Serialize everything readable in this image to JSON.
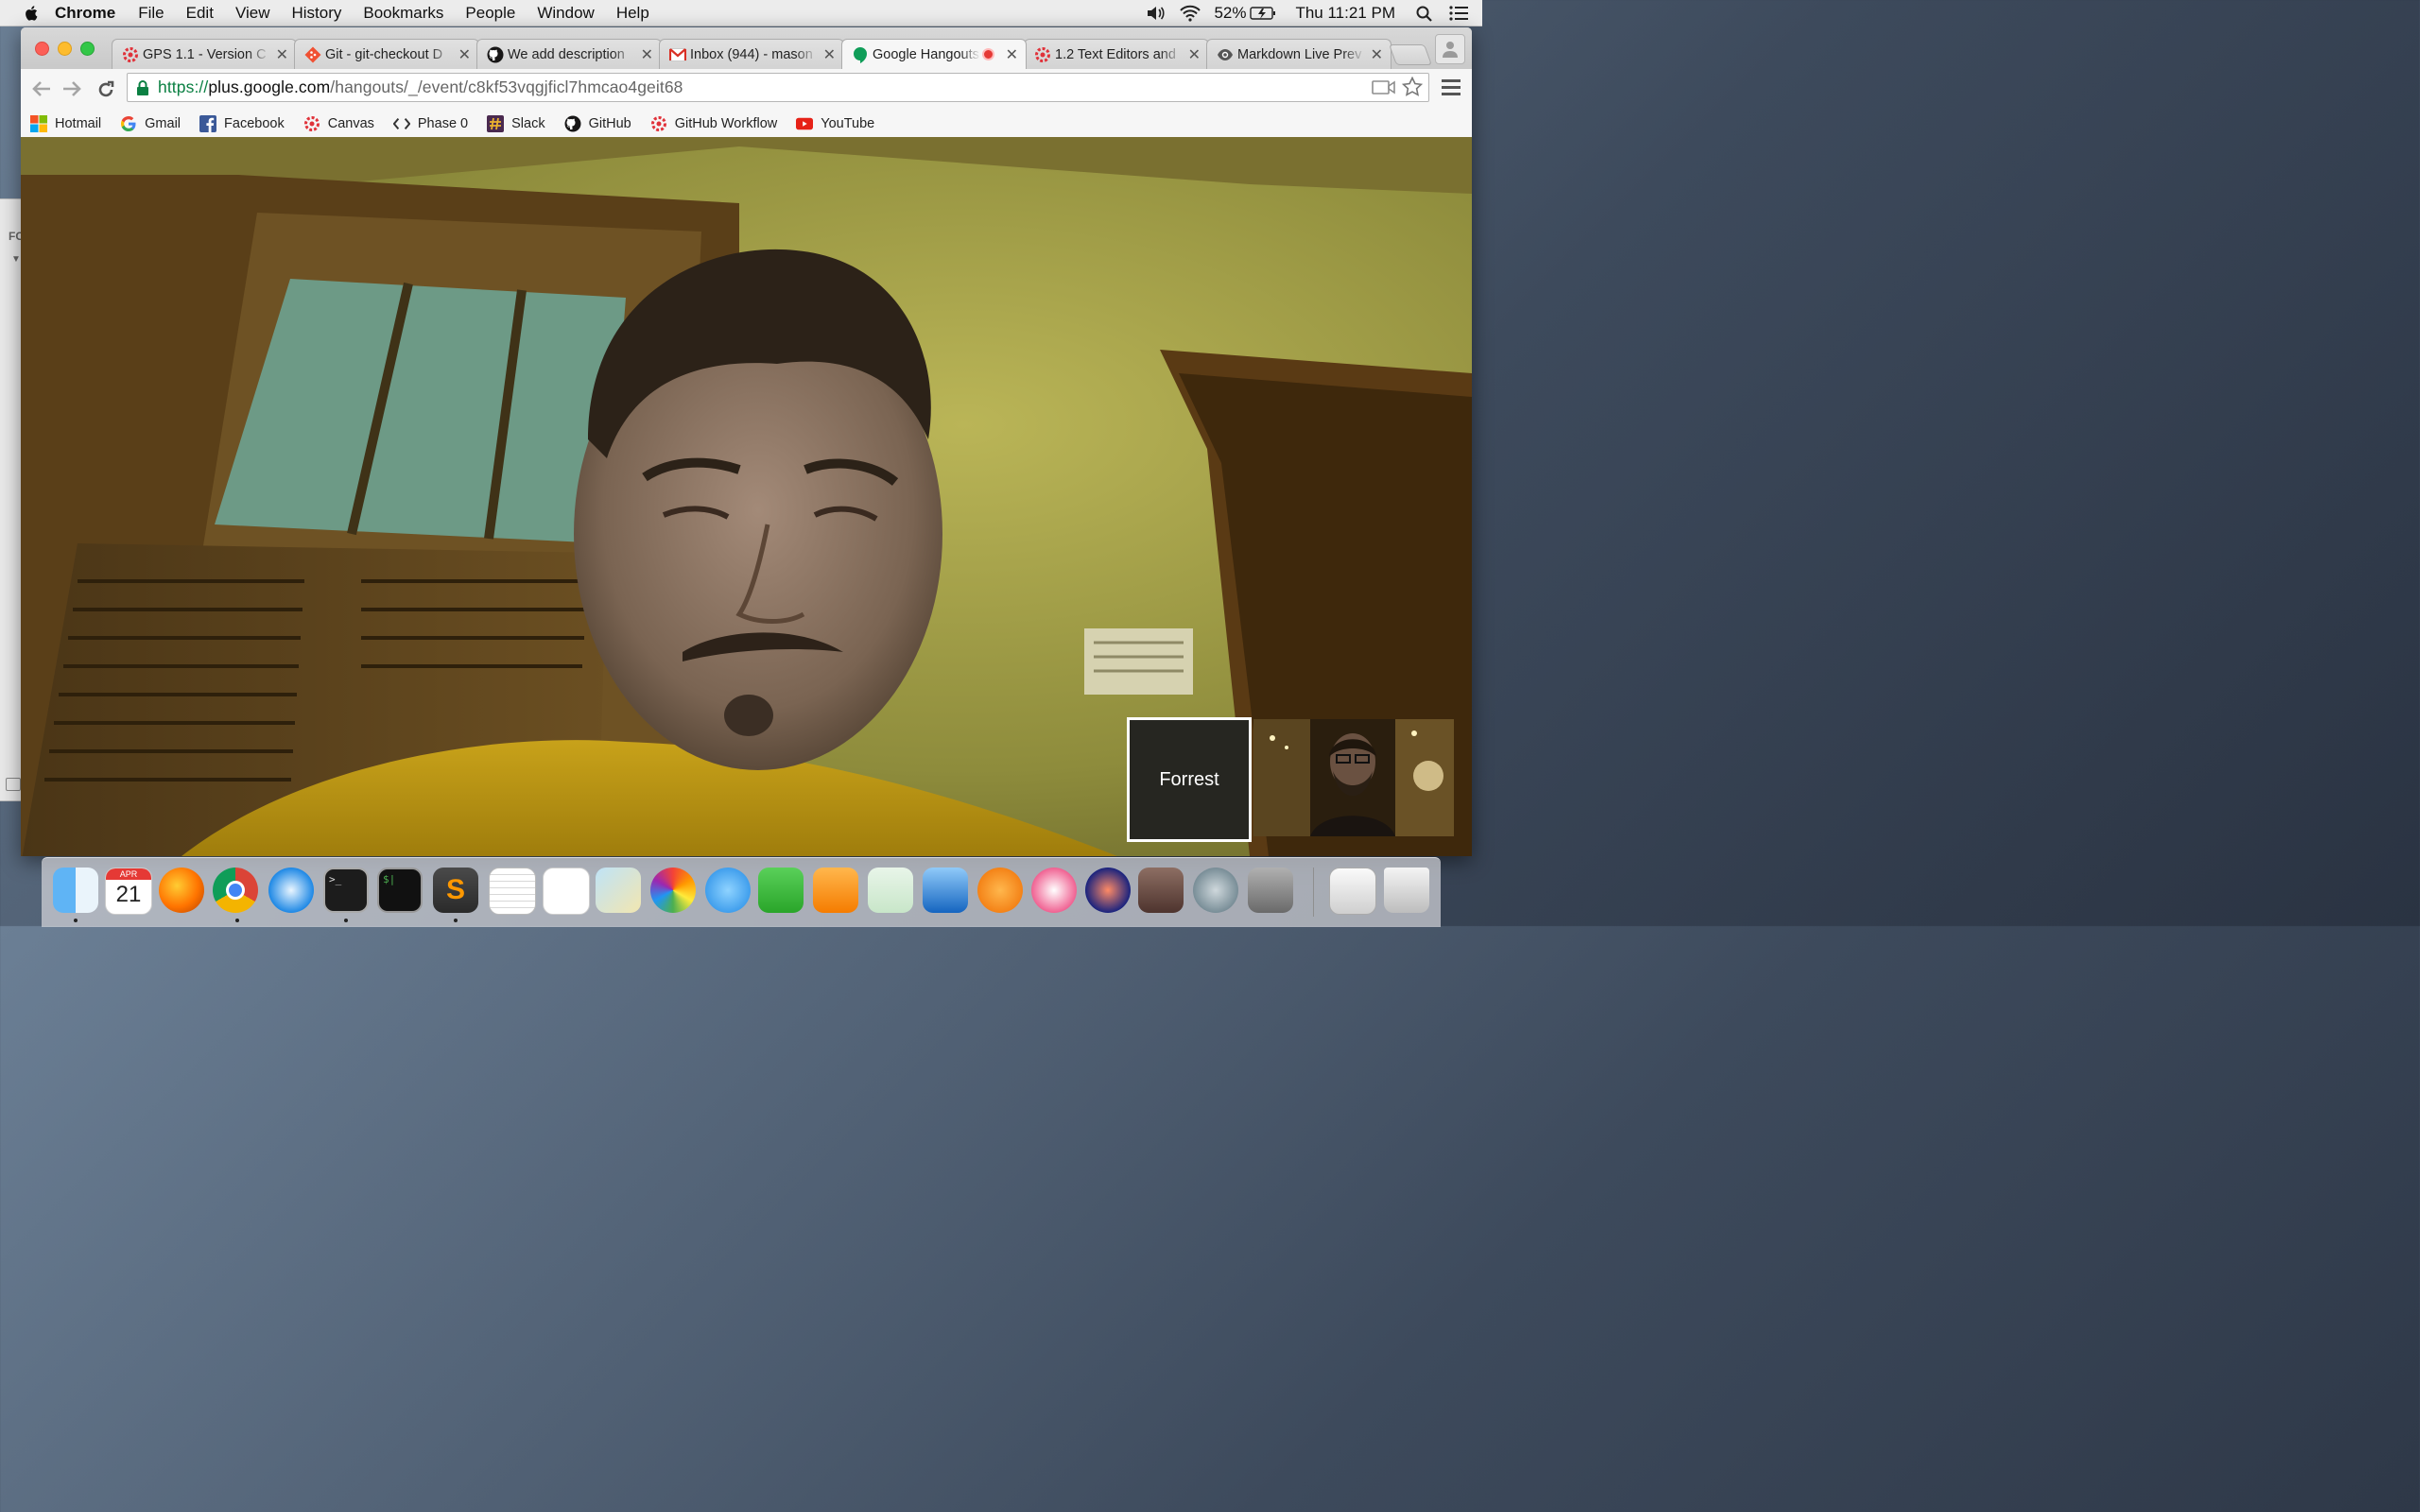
{
  "menubar": {
    "app_name": "Chrome",
    "menus": [
      "File",
      "Edit",
      "View",
      "History",
      "Bookmarks",
      "People",
      "Window",
      "Help"
    ],
    "battery": "52%",
    "clock": "Thu 11:21 PM"
  },
  "background_window": {
    "label_fragment": "FC"
  },
  "tabs": [
    {
      "title": "GPS 1.1 - Version C",
      "favicon": "gear-icon"
    },
    {
      "title": "Git - git-checkout D",
      "favicon": "git-icon"
    },
    {
      "title": "We add description",
      "favicon": "github-icon"
    },
    {
      "title": "Inbox (944) - mason",
      "favicon": "gmail-icon"
    },
    {
      "title": "Google Hangouts",
      "favicon": "hangouts-icon",
      "active": true,
      "recording": true
    },
    {
      "title": "1.2 Text Editors and",
      "favicon": "gear-icon"
    },
    {
      "title": "Markdown Live Prev",
      "favicon": "eye-icon"
    }
  ],
  "address_bar": {
    "scheme": "https://",
    "host": "plus.google.com",
    "path": "/hangouts/_/event/c8kf53vqgjficl7hmcao4geit68"
  },
  "bookmarks": [
    {
      "label": "Hotmail",
      "icon": "windows-icon"
    },
    {
      "label": "Gmail",
      "icon": "google-icon"
    },
    {
      "label": "Facebook",
      "icon": "facebook-icon"
    },
    {
      "label": "Canvas",
      "icon": "gear-icon"
    },
    {
      "label": "Phase 0",
      "icon": "code-icon"
    },
    {
      "label": "Slack",
      "icon": "slack-icon"
    },
    {
      "label": "GitHub",
      "icon": "github-icon"
    },
    {
      "label": "GitHub Workflow",
      "icon": "gear-icon"
    },
    {
      "label": "YouTube",
      "icon": "youtube-icon"
    }
  ],
  "hangout": {
    "participant_name": "Forrest"
  },
  "dock": {
    "calendar_month": "APR",
    "calendar_day": "21",
    "apps": [
      "Finder",
      "Calendar",
      "Firefox",
      "Chrome",
      "Safari",
      "Terminal",
      "iTerm",
      "Sublime Text",
      "TextEdit",
      "Reminders",
      "Preview",
      "Photos",
      "Messages",
      "FaceTime",
      "Pages",
      "Numbers",
      "Keynote",
      "iBooks",
      "iTunes",
      "Audacity",
      "GarageBand",
      "Launchpad",
      "System Preferences",
      "Downloads",
      "Trash"
    ]
  },
  "colors": {
    "url_scheme": "#0b8043",
    "tab_active": "#f6f6f6",
    "recording_red": "#e53935"
  }
}
